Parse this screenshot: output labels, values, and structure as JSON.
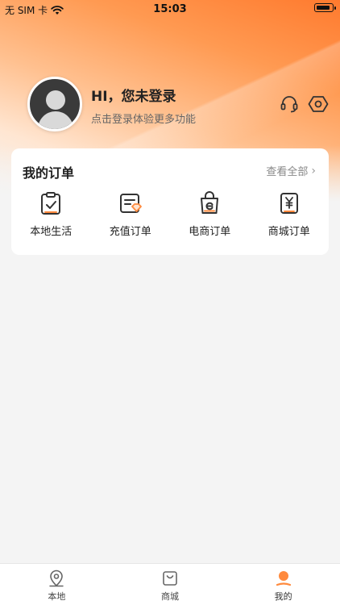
{
  "status_bar": {
    "carrier": "无 SIM 卡",
    "time": "15:03"
  },
  "profile": {
    "title": "HI，您未登录",
    "subtitle": "点击登录体验更多功能"
  },
  "orders": {
    "title": "我的订单",
    "view_all": "查看全部",
    "items": [
      {
        "label": "本地生活",
        "icon": "clipboard-check-icon"
      },
      {
        "label": "充值订单",
        "icon": "recharge-order-icon"
      },
      {
        "label": "电商订单",
        "icon": "shopping-bag-icon"
      },
      {
        "label": "商城订单",
        "icon": "yuan-receipt-icon"
      }
    ]
  },
  "tab_bar": {
    "tabs": [
      {
        "label": "本地",
        "icon": "location-pin-icon",
        "active": false
      },
      {
        "label": "商城",
        "icon": "bag-icon",
        "active": false
      },
      {
        "label": "我的",
        "icon": "person-icon",
        "active": true
      }
    ]
  },
  "colors": {
    "accent": "#ff8a3d",
    "brand_gradient_start": "#ff7a2e"
  }
}
